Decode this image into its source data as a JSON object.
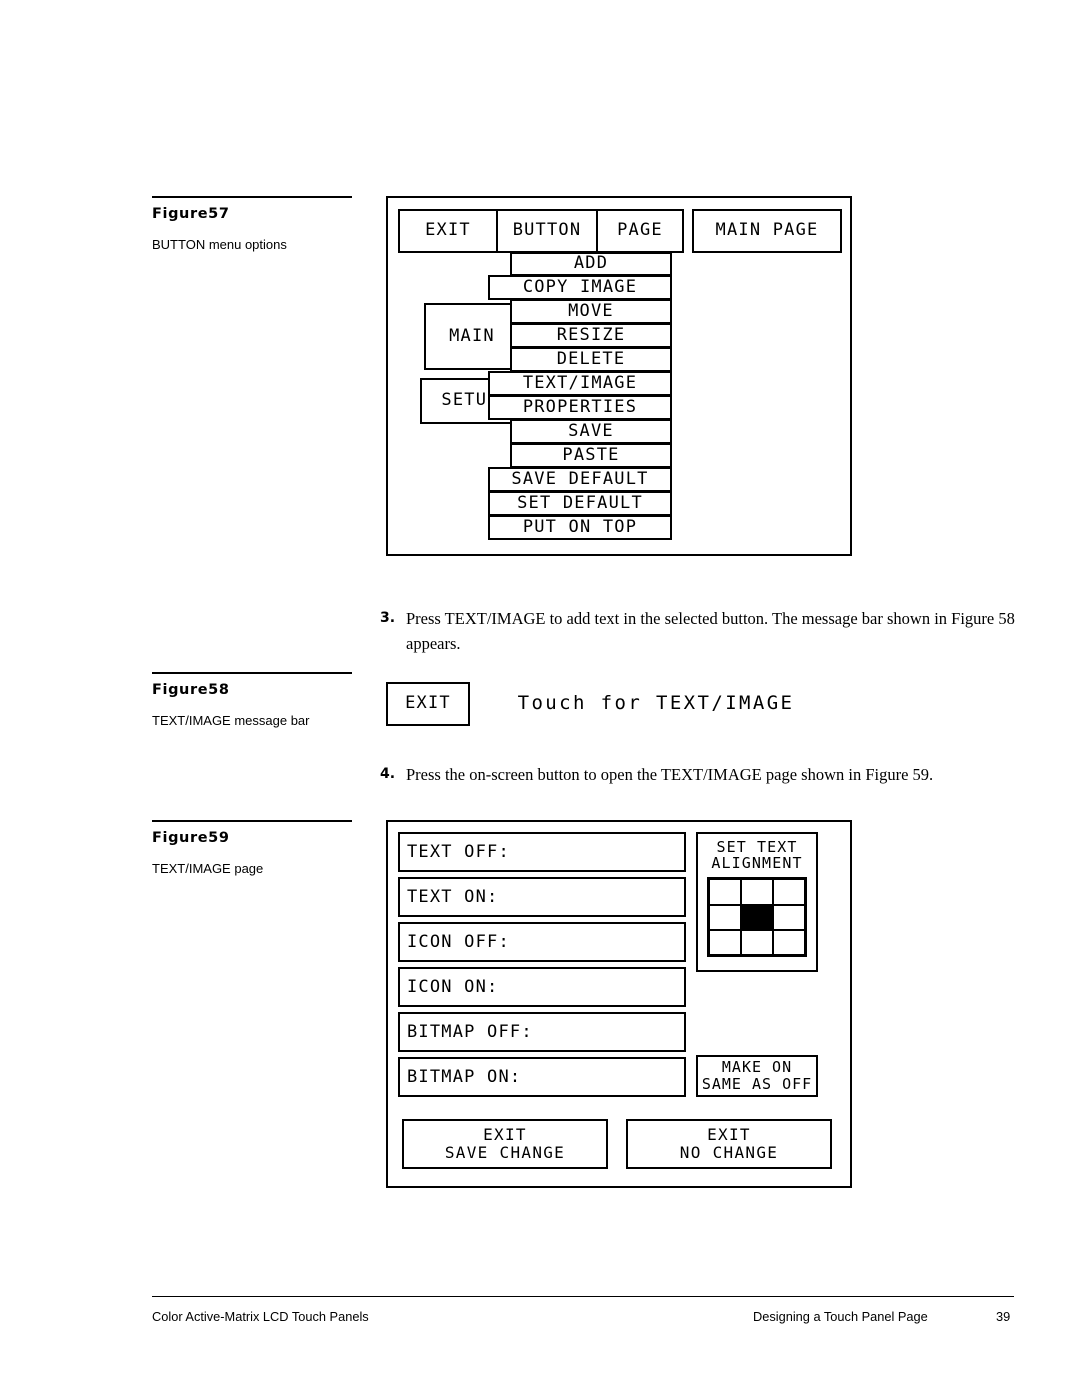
{
  "page": {
    "footer_left": "Color Active-Matrix LCD Touch Panels",
    "footer_right": "Designing a Touch Panel Page",
    "page_number": "39"
  },
  "figure57": {
    "title": "Figure57",
    "description": "BUTTON menu options",
    "toolbar": [
      {
        "label": "EXIT"
      },
      {
        "label": "BUTTON"
      },
      {
        "label": "PAGE"
      },
      {
        "label": "MAIN PAGE"
      }
    ],
    "background_keys": [
      {
        "label": "MAIN"
      },
      {
        "label": "SETUP"
      }
    ],
    "menu_items": [
      {
        "label": "ADD",
        "wide": false
      },
      {
        "label": "COPY IMAGE",
        "wide": true
      },
      {
        "label": "MOVE",
        "wide": false
      },
      {
        "label": "RESIZE",
        "wide": false
      },
      {
        "label": "DELETE",
        "wide": false
      },
      {
        "label": "TEXT/IMAGE",
        "wide": true
      },
      {
        "label": "PROPERTIES",
        "wide": true
      },
      {
        "label": "SAVE",
        "wide": false
      },
      {
        "label": "PASTE",
        "wide": false
      },
      {
        "label": "SAVE DEFAULT",
        "wide": true
      },
      {
        "label": "SET DEFAULT",
        "wide": true
      },
      {
        "label": "PUT ON TOP",
        "wide": true
      }
    ]
  },
  "step3": {
    "number": "3.",
    "text": "Press TEXT/IMAGE to add text in the selected button. The message bar shown in Figure 58 appears."
  },
  "figure58": {
    "title": "Figure58",
    "description": "TEXT/IMAGE message bar",
    "exit_label": "EXIT",
    "message": "Touch for TEXT/IMAGE"
  },
  "step4": {
    "number": "4.",
    "text": "Press the on-screen button to open the TEXT/IMAGE page shown in Figure 59."
  },
  "figure59": {
    "title": "Figure59",
    "description": "TEXT/IMAGE page",
    "fields": [
      {
        "label": "TEXT OFF:",
        "value": ""
      },
      {
        "label": "TEXT ON:",
        "value": ""
      },
      {
        "label": "ICON OFF:",
        "value": ""
      },
      {
        "label": "ICON ON:",
        "value": ""
      },
      {
        "label": "BITMAP OFF:",
        "value": ""
      },
      {
        "label": "BITMAP ON:",
        "value": ""
      }
    ],
    "alignment": {
      "title": "SET TEXT\nALIGNMENT",
      "rows": 3,
      "cols": 3,
      "selected_cell": 4
    },
    "make_on_same_as_off": "MAKE ON\nSAME AS OFF",
    "exit_save": "EXIT\nSAVE CHANGE",
    "exit_no_change": "EXIT\nNO CHANGE"
  }
}
